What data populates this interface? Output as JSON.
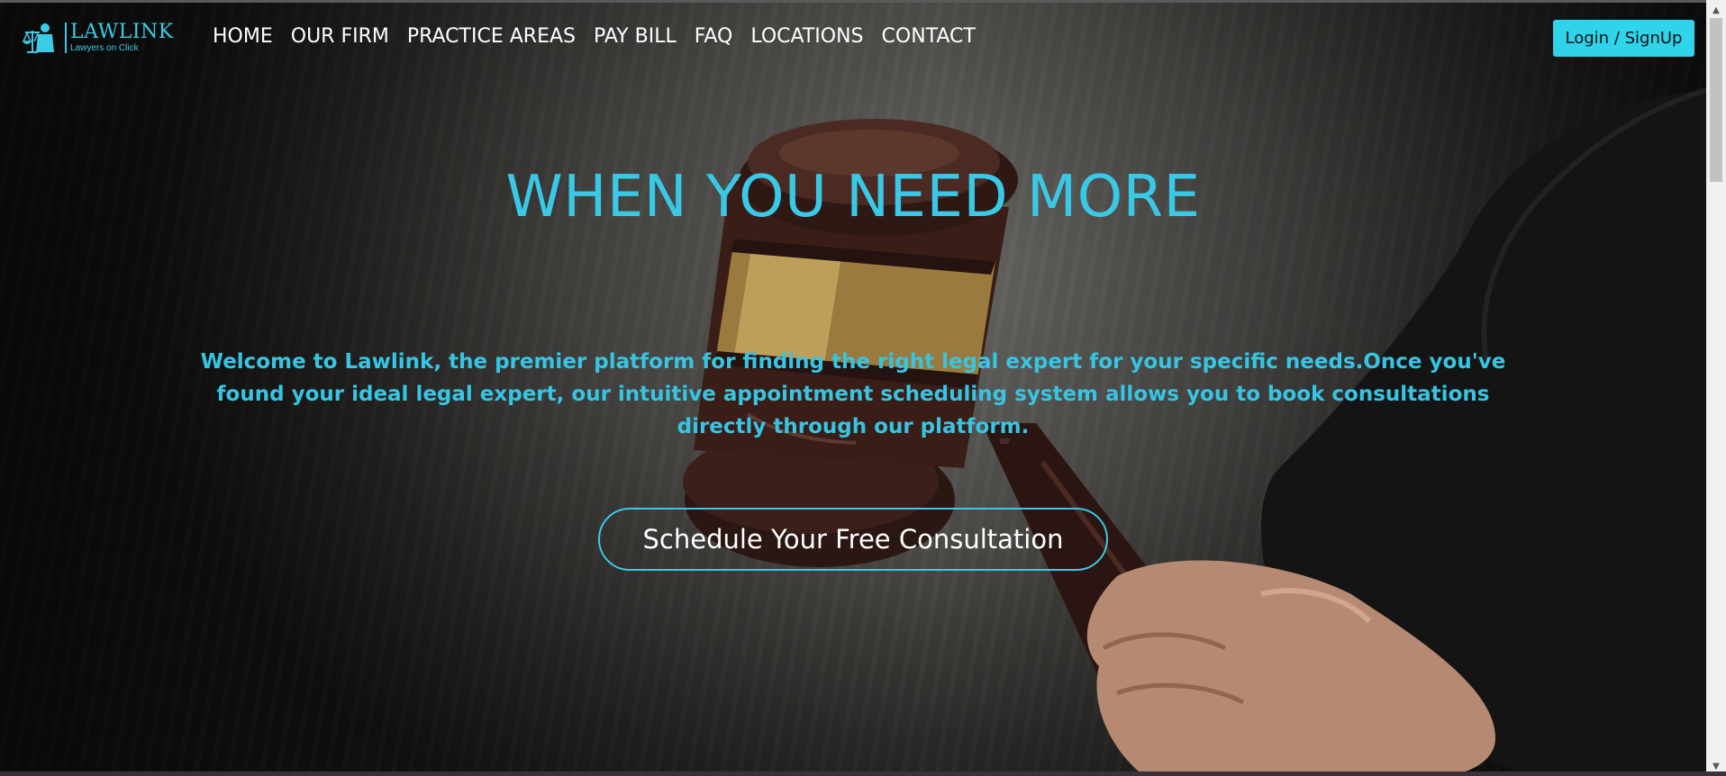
{
  "logo": {
    "name": "LAWLINK",
    "tagline": "Lawyers on Click",
    "icon": "scales-of-justice-icon"
  },
  "nav": {
    "items": [
      {
        "label": "HOME"
      },
      {
        "label": "OUR FIRM"
      },
      {
        "label": "PRACTICE AREAS"
      },
      {
        "label": "PAY BILL"
      },
      {
        "label": "FAQ"
      },
      {
        "label": "LOCATIONS"
      },
      {
        "label": "CONTACT"
      }
    ]
  },
  "header": {
    "login_label": "Login / SignUp"
  },
  "hero": {
    "headline": "WHEN YOU NEED MORE",
    "intro": "Welcome to Lawlink, the premier platform for finding the right legal expert for your specific needs.Once you've found your ideal legal expert, our intuitive appointment scheduling system allows you to book consultations directly through our platform.",
    "cta_label": "Schedule Your Free Consultation",
    "background_image": "gavel-in-hand"
  },
  "colors": {
    "accent": "#39c9e6",
    "button_bg": "#2fd3ea",
    "nav_text": "#ffffff"
  }
}
